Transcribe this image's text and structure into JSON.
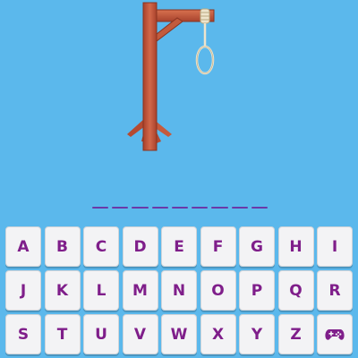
{
  "game": {
    "word_length": 9,
    "keys": [
      "A",
      "B",
      "C",
      "D",
      "E",
      "F",
      "G",
      "H",
      "I",
      "J",
      "K",
      "L",
      "M",
      "N",
      "O",
      "P",
      "Q",
      "R",
      "S",
      "T",
      "U",
      "V",
      "W",
      "X",
      "Y",
      "Z"
    ],
    "extra_key_icon": "gamepad-icon"
  },
  "colors": {
    "background": "#5bb8ec",
    "key_text": "#7f1e8a",
    "key_face": "#f3f3f5",
    "word_slot": "#6a3aa8",
    "wood": "#c55a3c"
  }
}
